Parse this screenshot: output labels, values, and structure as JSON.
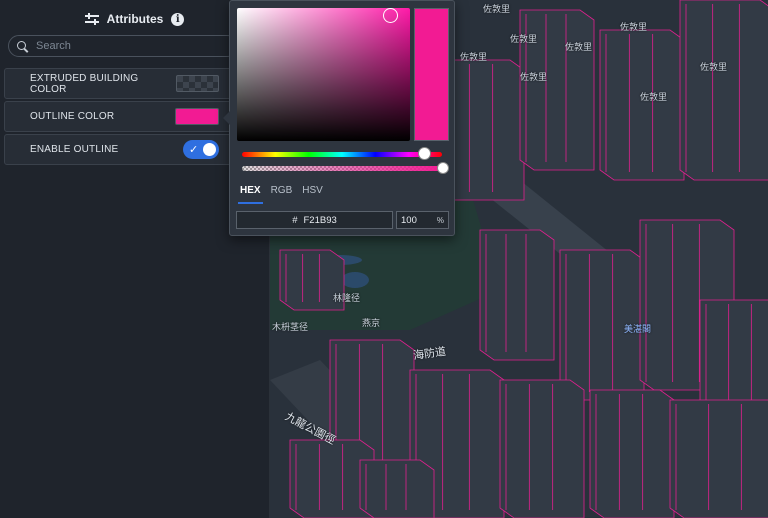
{
  "panel": {
    "title": "Attributes",
    "info_icon": "i",
    "search_placeholder": "Search",
    "rows": [
      {
        "label": "EXTRUDED BUILDING COLOR",
        "control": "color-swatch-transparent"
      },
      {
        "label": "OUTLINE COLOR",
        "control": "color-swatch",
        "color": "#F21B93"
      },
      {
        "label": "ENABLE OUTLINE",
        "control": "toggle",
        "checked": true
      }
    ]
  },
  "picker": {
    "tabs": [
      "HEX",
      "RGB",
      "HSV"
    ],
    "active_tab": "HEX",
    "hex_prefix": "#",
    "hex_value": "F21B93",
    "alpha_value": "100",
    "alpha_unit": "%",
    "selected_color": "#F21B93",
    "hue_fraction": 0.93,
    "alpha_fraction": 1.0
  },
  "map": {
    "labels": [
      "佐敦里",
      "佐敦里",
      "佐敦里",
      "佐敦里",
      "佐敦里",
      "佐敦里",
      "佐敦里",
      "佐敦里",
      "林隆径",
      "木枡茎径",
      "燕京",
      "海防道",
      "九龍公園徑",
      "美湛閣"
    ]
  },
  "colors": {
    "accent": "#2F6FE0",
    "outline": "#F21B93",
    "panel_bg": "#1F242C",
    "map_bg": "#29313B"
  }
}
